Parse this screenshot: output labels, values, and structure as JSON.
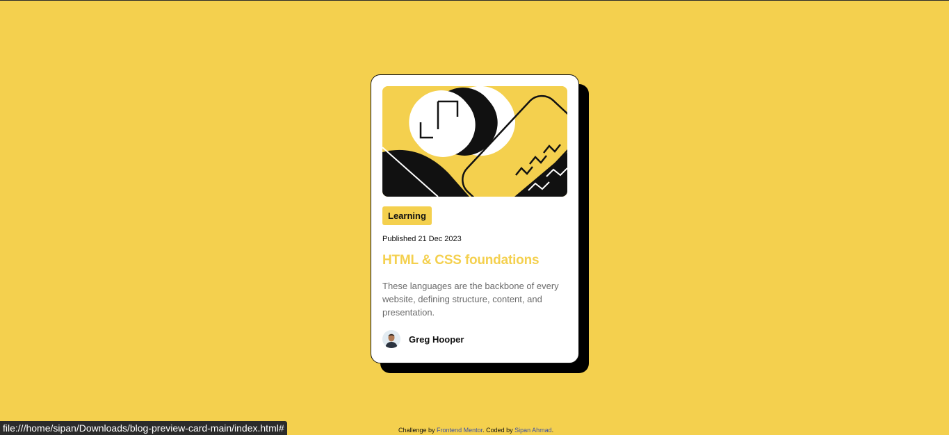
{
  "card": {
    "tag": "Learning",
    "published": "Published 21 Dec 2023",
    "title": "HTML & CSS foundations",
    "description": "These languages are the backbone of every website, defining structure, content, and presentation.",
    "author": "Greg Hooper"
  },
  "footer": {
    "prefix": "Challenge by ",
    "frontend_link": "Frontend Mentor",
    "middle": ". Coded by ",
    "author_link": "Sipan Ahmad",
    "suffix": "."
  },
  "statusbar": {
    "url": "file:///home/sipan/Downloads/blog-preview-card-main/index.html#"
  },
  "colors": {
    "background": "#f4d04e",
    "card": "#ffffff",
    "shadow": "#000000",
    "link": "#3e52a3"
  },
  "icons": [
    "illustration-article",
    "avatar-greg-hooper"
  ]
}
